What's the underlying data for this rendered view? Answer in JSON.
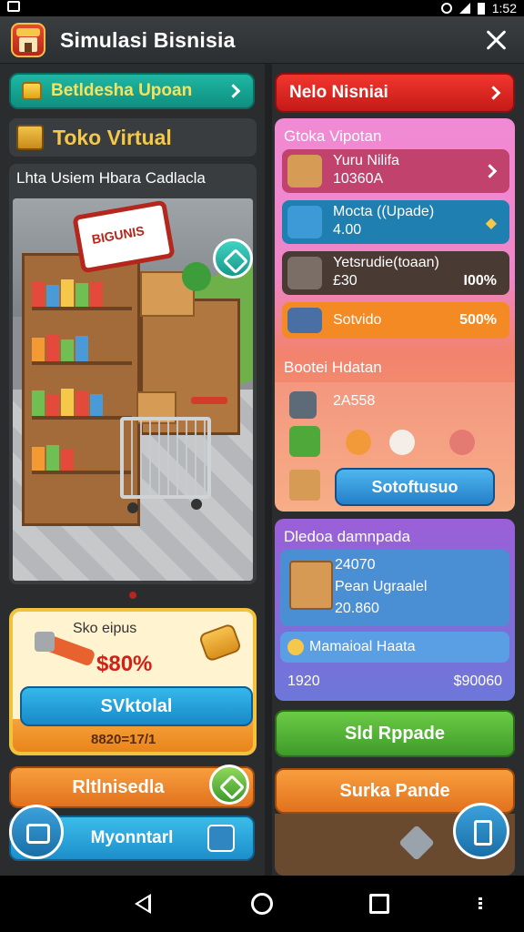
{
  "status_bar": {
    "time": "1:52"
  },
  "app": {
    "title": "Simulasi Bisnisia"
  },
  "left": {
    "top_button": "Betldesha Upoan",
    "toko_title": "Toko Virtual",
    "store_subtitle": "Lhta Usiem Hbara Cadlacla",
    "store_sign": "BIGUNIS",
    "promo": {
      "label": "Sko eipus",
      "value": "$80%",
      "button": "SVktolal",
      "sub": "8820=17/1"
    },
    "orange_button": "Rltlnisedla",
    "blue_button": "Myonntarl"
  },
  "right": {
    "red_button": "Nelo Nisniai",
    "pink_panel": {
      "header": "Gtoka Vipotan",
      "rows": [
        {
          "t1": "Yuru Nilifa",
          "t2": "10360A",
          "right": ""
        },
        {
          "t1": "Mocta ((Upade)",
          "t2": "4.00",
          "right": ""
        },
        {
          "t1": "Yetsrudie(toaan)",
          "t2": "£30",
          "right": "I00%"
        },
        {
          "t1": "Sotvido",
          "t2": "",
          "right": "500%"
        }
      ],
      "sub_header": "Bootei Hdatan",
      "sub_value": "2A558",
      "button": "Sotoftusuo"
    },
    "purple_panel": {
      "header": "Dledoa damnpada",
      "val1": "24070",
      "val2": "Pean Ugraalel",
      "val3": "20.860",
      "row_label": "Mamaioal Haata",
      "left_num": "1920",
      "right_num": "$90060"
    },
    "green_button": "Sld Rppade",
    "orange_button": "Surka Pande"
  }
}
